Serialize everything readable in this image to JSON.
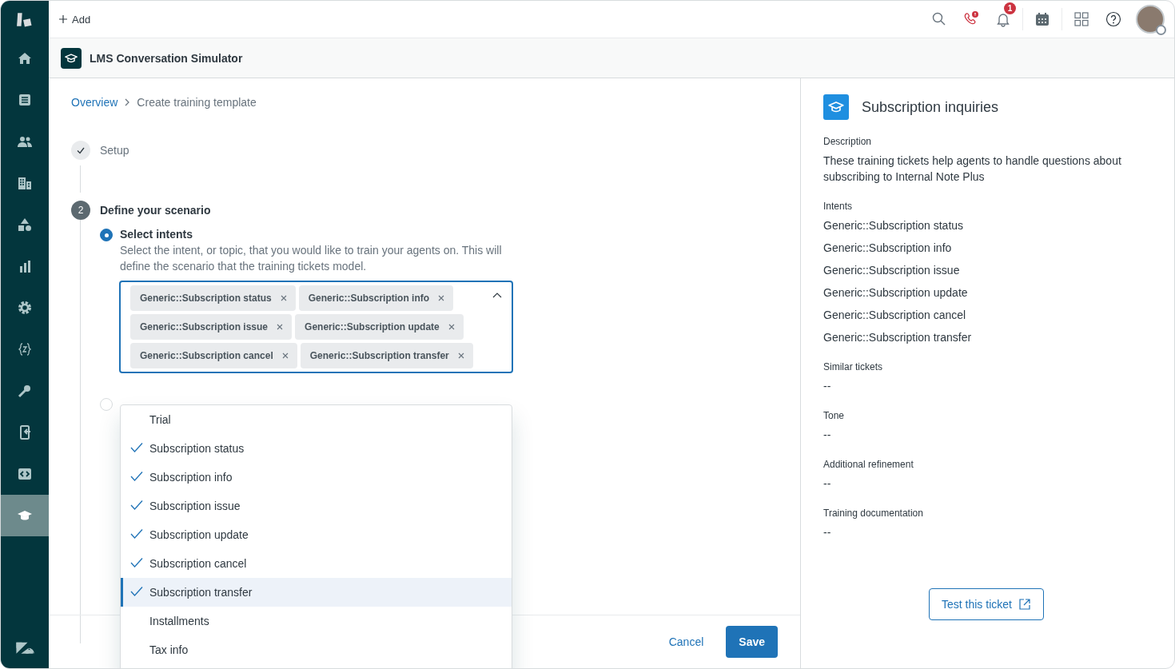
{
  "sidebar": {
    "items": [
      {
        "selected": false
      },
      {
        "selected": false
      },
      {
        "selected": false
      },
      {
        "selected": false
      },
      {
        "selected": false
      },
      {
        "selected": false
      },
      {
        "selected": false
      },
      {
        "selected": false
      },
      {
        "selected": false
      },
      {
        "selected": false
      },
      {
        "selected": false
      },
      {
        "selected": true
      }
    ]
  },
  "topbar": {
    "add_label": "Add",
    "notification_count": "1"
  },
  "app_header": {
    "title": "LMS Conversation Simulator"
  },
  "breadcrumb": [
    "Overview",
    "Create training template"
  ],
  "steps": [
    {
      "kind": "done",
      "label": "Setup"
    },
    {
      "kind": "current",
      "number": "2",
      "label": "Define your scenario"
    }
  ],
  "scenario_options": [
    {
      "label": "Select intents",
      "description": "Select the intent, or topic, that you would like to train your agents on. This will define the scenario that the training tickets model.",
      "selected": true
    },
    {
      "selected": false
    }
  ],
  "intent_field": {
    "expanded": true,
    "tags": [
      "Generic::Subscription status",
      "Generic::Subscription info",
      "Generic::Subscription issue",
      "Generic::Subscription update",
      "Generic::Subscription cancel",
      "Generic::Subscription transfer"
    ]
  },
  "intent_menu": [
    {
      "label": "Trial",
      "checked": false,
      "focused": false
    },
    {
      "label": "Subscription status",
      "checked": true,
      "focused": false
    },
    {
      "label": "Subscription info",
      "checked": true,
      "focused": false
    },
    {
      "label": "Subscription issue",
      "checked": true,
      "focused": false
    },
    {
      "label": "Subscription update",
      "checked": true,
      "focused": false
    },
    {
      "label": "Subscription cancel",
      "checked": true,
      "focused": false
    },
    {
      "label": "Subscription transfer",
      "checked": true,
      "focused": true
    },
    {
      "label": "Installments",
      "checked": false,
      "focused": false
    },
    {
      "label": "Tax info",
      "checked": false,
      "focused": false
    }
  ],
  "footer": {
    "cancel": "Cancel",
    "save": "Save"
  },
  "details": {
    "title": "Subscription inquiries",
    "sections": [
      {
        "label": "Description",
        "values": [
          "These training tickets help agents to handle questions about subscribing to Internal Note Plus"
        ]
      },
      {
        "label": "Intents",
        "values": [
          "Generic::Subscription status",
          "Generic::Subscription info",
          "Generic::Subscription issue",
          "Generic::Subscription update",
          "Generic::Subscription cancel",
          "Generic::Subscription transfer"
        ]
      },
      {
        "label": "Similar tickets",
        "values": [
          "--"
        ]
      },
      {
        "label": "Tone",
        "values": [
          "--"
        ]
      },
      {
        "label": "Additional refinement",
        "values": [
          "--"
        ]
      },
      {
        "label": "Training documentation",
        "values": [
          "--"
        ]
      }
    ],
    "button": "Test this ticket"
  }
}
